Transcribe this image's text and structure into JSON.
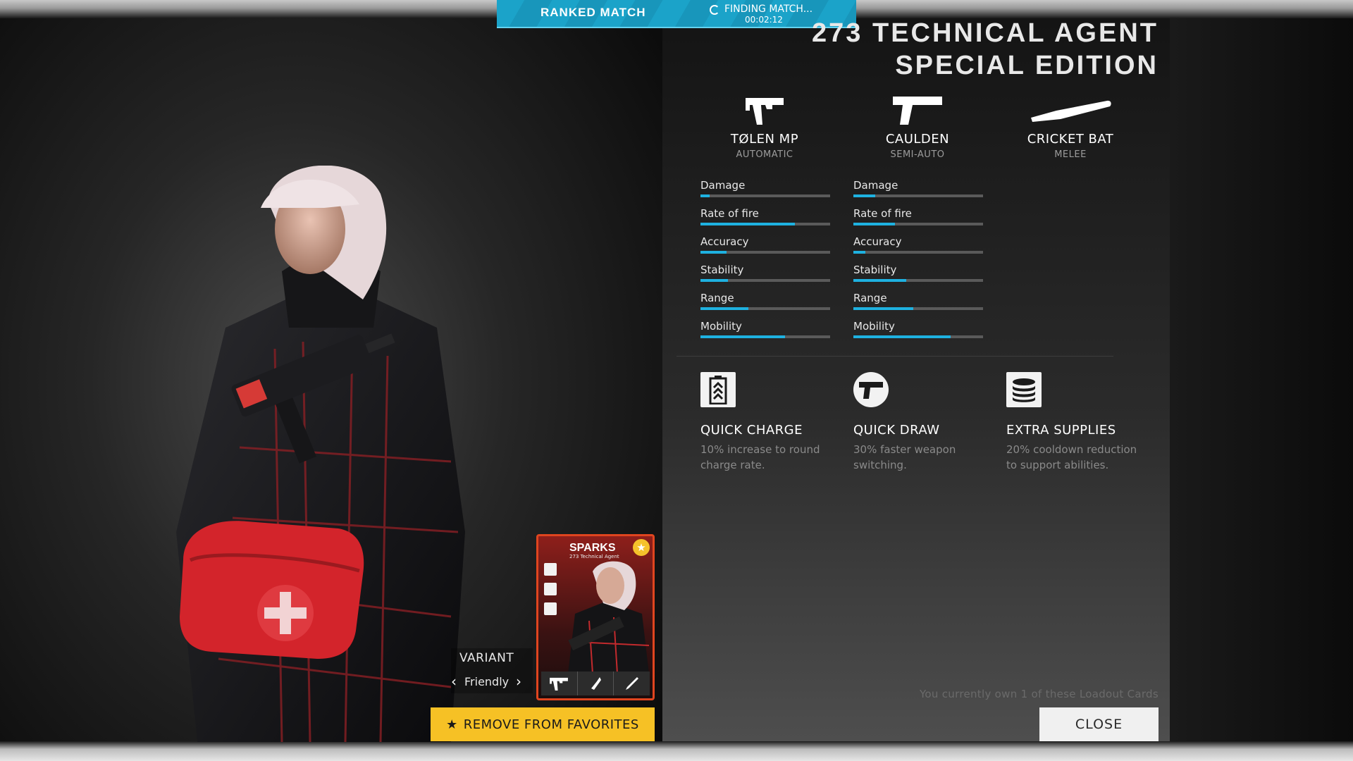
{
  "match": {
    "mode_label": "RANKED MATCH",
    "status_label": "FINDING MATCH...",
    "timer": "00:02:12"
  },
  "loadout": {
    "title_line1": "273 TECHNICAL AGENT",
    "title_line2": "SPECIAL EDITION"
  },
  "weapons": [
    {
      "name": "TØLEN MP",
      "type": "AUTOMATIC",
      "icon": "smg-icon",
      "stats": [
        {
          "label": "Damage",
          "value": 0.07
        },
        {
          "label": "Rate of fire",
          "value": 0.73
        },
        {
          "label": "Accuracy",
          "value": 0.2
        },
        {
          "label": "Stability",
          "value": 0.21
        },
        {
          "label": "Range",
          "value": 0.37
        },
        {
          "label": "Mobility",
          "value": 0.65
        }
      ]
    },
    {
      "name": "CAULDEN",
      "type": "SEMI-AUTO",
      "icon": "pistol-icon",
      "stats": [
        {
          "label": "Damage",
          "value": 0.17
        },
        {
          "label": "Rate of fire",
          "value": 0.32
        },
        {
          "label": "Accuracy",
          "value": 0.09
        },
        {
          "label": "Stability",
          "value": 0.41
        },
        {
          "label": "Range",
          "value": 0.46
        },
        {
          "label": "Mobility",
          "value": 0.75
        }
      ]
    },
    {
      "name": "CRICKET BAT",
      "type": "MELEE",
      "icon": "cricket-bat-icon"
    }
  ],
  "perks": [
    {
      "name": "QUICK CHARGE",
      "description": "10% increase to round charge rate.",
      "icon": "battery-charge-icon"
    },
    {
      "name": "QUICK DRAW",
      "description": "30% faster weapon switching.",
      "icon": "holster-icon"
    },
    {
      "name": "EXTRA SUPPLIES",
      "description": "20% cooldown reduction to support abilities.",
      "icon": "supplies-stack-icon"
    }
  ],
  "card": {
    "name": "SPARKS",
    "subtitle": "273 Technical Agent",
    "favorite": true
  },
  "variant": {
    "label": "VARIANT",
    "value": "Friendly"
  },
  "actions": {
    "favorite_label": "REMOVE FROM FAVORITES",
    "close_label": "CLOSE"
  },
  "ownership_text": "You currently own 1 of these Loadout Cards",
  "colors": {
    "accent": "#1eb1e0",
    "favorite_button": "#f6c125",
    "card_border": "#e0451f",
    "banner": "#1ba3c9"
  }
}
